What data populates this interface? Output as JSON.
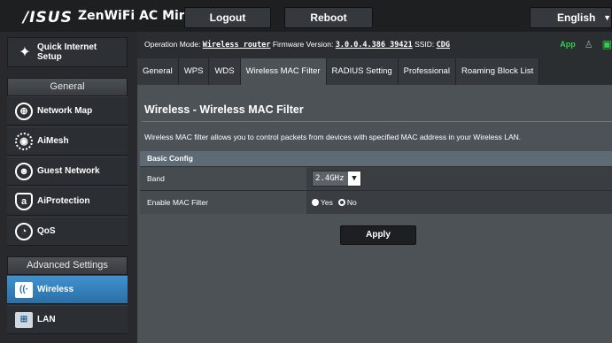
{
  "header": {
    "logo": "/ISUS",
    "model": "ZenWiFi AC Mini",
    "logout_label": "Logout",
    "reboot_label": "Reboot",
    "language": "English"
  },
  "status": {
    "op_mode_label": "Operation Mode:",
    "op_mode_value": "Wireless router",
    "firmware_label": "Firmware Version:",
    "firmware_value": "3.0.0.4.386_39421",
    "ssid_label": "SSID:",
    "ssid_value": "CDG",
    "app_label": "App"
  },
  "sidebar": {
    "qis_label": "Quick Internet\nSetup",
    "general_header": "General",
    "general_items": [
      {
        "label": "Network Map",
        "icon": "globe-icon"
      },
      {
        "label": "AiMesh",
        "icon": "aimesh-icon"
      },
      {
        "label": "Guest Network",
        "icon": "guest-network-icon"
      },
      {
        "label": "AiProtection",
        "icon": "shield-icon"
      },
      {
        "label": "QoS",
        "icon": "speedometer-icon"
      }
    ],
    "advanced_header": "Advanced Settings",
    "advanced_items": [
      {
        "label": "Wireless",
        "icon": "wifi-icon",
        "active": true
      },
      {
        "label": "LAN",
        "icon": "lan-icon",
        "active": false
      }
    ]
  },
  "tabs": [
    {
      "label": "General",
      "active": false
    },
    {
      "label": "WPS",
      "active": false
    },
    {
      "label": "WDS",
      "active": false
    },
    {
      "label": "Wireless MAC Filter",
      "active": true
    },
    {
      "label": "RADIUS Setting",
      "active": false
    },
    {
      "label": "Professional",
      "active": false
    },
    {
      "label": "Roaming Block List",
      "active": false
    }
  ],
  "main": {
    "title": "Wireless - Wireless MAC Filter",
    "description": "Wireless MAC filter allows you to control packets from devices with specified MAC address in your Wireless LAN.",
    "section_header": "Basic Config",
    "band_label": "Band",
    "band_value": "2.4GHz",
    "enable_label": "Enable MAC Filter",
    "radio_yes": "Yes",
    "radio_no": "No",
    "selected_option": "Yes",
    "apply_label": "Apply"
  },
  "colors": {
    "active_nav": "#3f92d0",
    "app_green": "#2ed14b",
    "section_header": "#5e6a74"
  }
}
